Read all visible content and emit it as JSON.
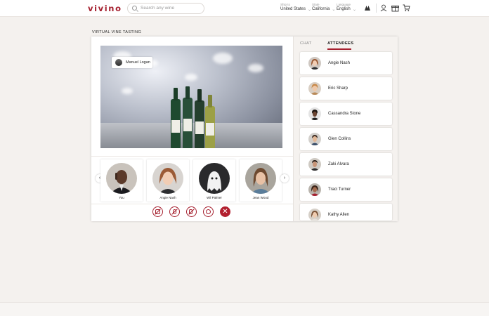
{
  "header": {
    "logo": "vivino",
    "search_placeholder": "Search any wine",
    "ship_to_label": "Ship to",
    "ship_to_value": "United States",
    "state_label": "State",
    "state_value": "California",
    "language_label": "Language",
    "language_value": "English",
    "icons": [
      "wine-glasses-icon",
      "user-icon",
      "gift-icon",
      "cart-icon"
    ]
  },
  "page": {
    "title": "VIRTUAL VINE TASTING"
  },
  "video": {
    "host_name": "Manuel Logan"
  },
  "participants": [
    {
      "name": "You"
    },
    {
      "name": "Angie Nash"
    },
    {
      "name": "Wil Palmer"
    },
    {
      "name": "Jean Wood"
    }
  ],
  "controls": [
    "video-off-icon",
    "mic-off-icon",
    "speaker-off-icon",
    "emoji-icon",
    "end-call-icon"
  ],
  "tabs": [
    {
      "label": "CHAT",
      "active": false
    },
    {
      "label": "ATTENDEES",
      "active": true
    }
  ],
  "attendees": [
    {
      "name": "Angie Nash"
    },
    {
      "name": "Eric Sharp"
    },
    {
      "name": "Cassandra Stone"
    },
    {
      "name": "Glen Collins"
    },
    {
      "name": "Zaki Alvara"
    },
    {
      "name": "Traci Turner"
    },
    {
      "name": "Kathy Allen"
    }
  ],
  "colors": {
    "brand": "#a5202f",
    "background": "#f4f1ee",
    "card": "#ffffff"
  }
}
